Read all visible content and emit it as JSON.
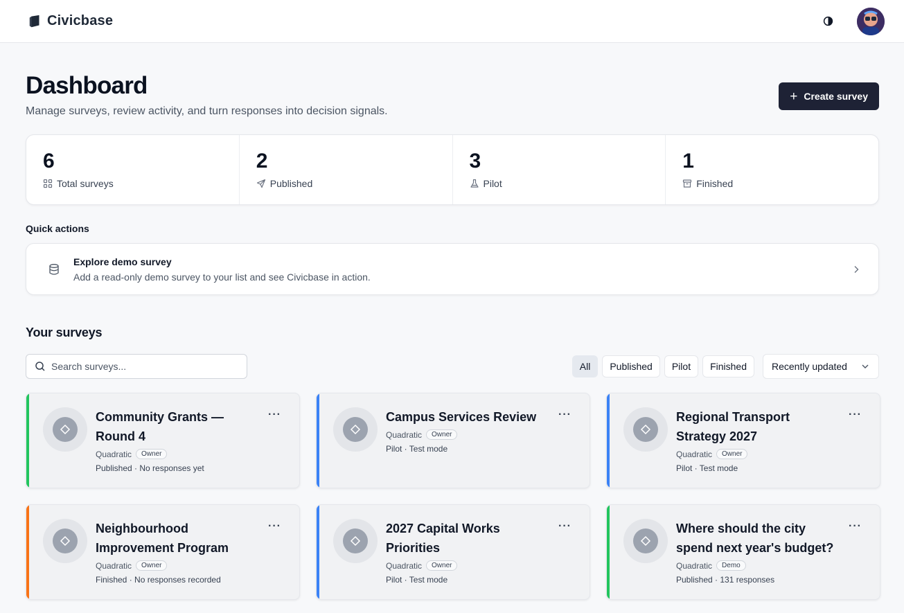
{
  "brand": {
    "name": "Civicbase"
  },
  "header": {
    "title": "Dashboard",
    "subtitle": "Manage surveys, review activity, and turn responses into decision signals.",
    "create_label": "Create survey"
  },
  "stats": [
    {
      "value": "6",
      "label": "Total surveys",
      "icon": "grid-icon"
    },
    {
      "value": "2",
      "label": "Published",
      "icon": "send-icon"
    },
    {
      "value": "3",
      "label": "Pilot",
      "icon": "flask-icon"
    },
    {
      "value": "1",
      "label": "Finished",
      "icon": "archive-icon"
    }
  ],
  "quick_actions": {
    "title": "Quick actions",
    "items": [
      {
        "name": "Explore demo survey",
        "description": "Add a read-only demo survey to your list and see Civicbase in action.",
        "icon": "database-icon"
      }
    ]
  },
  "surveys": {
    "title": "Your surveys",
    "search_placeholder": "Search surveys...",
    "filters": [
      "All",
      "Published",
      "Pilot",
      "Finished"
    ],
    "active_filter": "All",
    "sort_label": "Recently updated",
    "items": [
      {
        "title": "Community Grants — Round 4",
        "type": "Quadratic",
        "role": "Owner",
        "status": "Published · No responses yet",
        "accent": "#22c55e"
      },
      {
        "title": "Campus Services Review",
        "type": "Quadratic",
        "role": "Owner",
        "status": "Pilot · Test mode",
        "accent": "#3b82f6"
      },
      {
        "title": "Regional Transport Strategy 2027",
        "type": "Quadratic",
        "role": "Owner",
        "status": "Pilot · Test mode",
        "accent": "#3b82f6"
      },
      {
        "title": "Neighbourhood Improvement Program",
        "type": "Quadratic",
        "role": "Owner",
        "status": "Finished · No responses recorded",
        "accent": "#f97316"
      },
      {
        "title": "2027 Capital Works Priorities",
        "type": "Quadratic",
        "role": "Owner",
        "status": "Pilot · Test mode",
        "accent": "#3b82f6"
      },
      {
        "title": "Where should the city spend next year's budget?",
        "type": "Quadratic",
        "role": "Demo",
        "status": "Published · 131 responses",
        "accent": "#22c55e"
      }
    ],
    "menu_label": "···"
  }
}
